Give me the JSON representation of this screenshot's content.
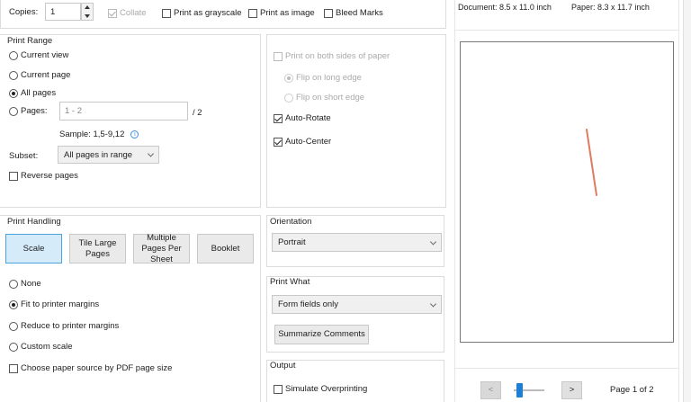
{
  "copies": {
    "label": "Copies:",
    "value": "1"
  },
  "top_options": {
    "collate": "Collate",
    "grayscale": "Print as grayscale",
    "image": "Print as image",
    "bleed": "Bleed Marks"
  },
  "print_range": {
    "title": "Print Range",
    "current_view": "Current view",
    "current_page": "Current page",
    "all_pages": "All pages",
    "pages_label": "Pages:",
    "pages_placeholder": "1 - 2",
    "pages_total": "/ 2",
    "sample": "Sample: 1,5-9,12",
    "subset_label": "Subset:",
    "subset_value": "All pages in range",
    "reverse": "Reverse pages"
  },
  "duplex": {
    "both_sides": "Print on both sides of paper",
    "flip_long": "Flip on long edge",
    "flip_short": "Flip on short edge",
    "auto_rotate": "Auto-Rotate",
    "auto_center": "Auto-Center"
  },
  "print_handling": {
    "title": "Print Handling",
    "tabs": [
      "Scale",
      "Tile Large Pages",
      "Multiple Pages Per Sheet",
      "Booklet"
    ],
    "none": "None",
    "fit": "Fit to printer margins",
    "reduce": "Reduce to printer margins",
    "custom": "Custom scale",
    "paper_source": "Choose paper source by PDF page size"
  },
  "orientation": {
    "title": "Orientation",
    "value": "Portrait"
  },
  "print_what": {
    "title": "Print What",
    "value": "Form fields only",
    "summarize": "Summarize Comments"
  },
  "output": {
    "title": "Output",
    "simulate": "Simulate Overprinting"
  },
  "preview": {
    "document": "Document: 8.5 x 11.0 inch",
    "paper": "Paper: 8.3 x 11.7 inch",
    "prev": "<",
    "next": ">",
    "page_info": "Page 1 of 2",
    "slider_level": 0.1,
    "colors": {
      "mark": "#e07a5f",
      "active_tab": "#d6ebfa",
      "slider": "#1e7fd6"
    }
  }
}
